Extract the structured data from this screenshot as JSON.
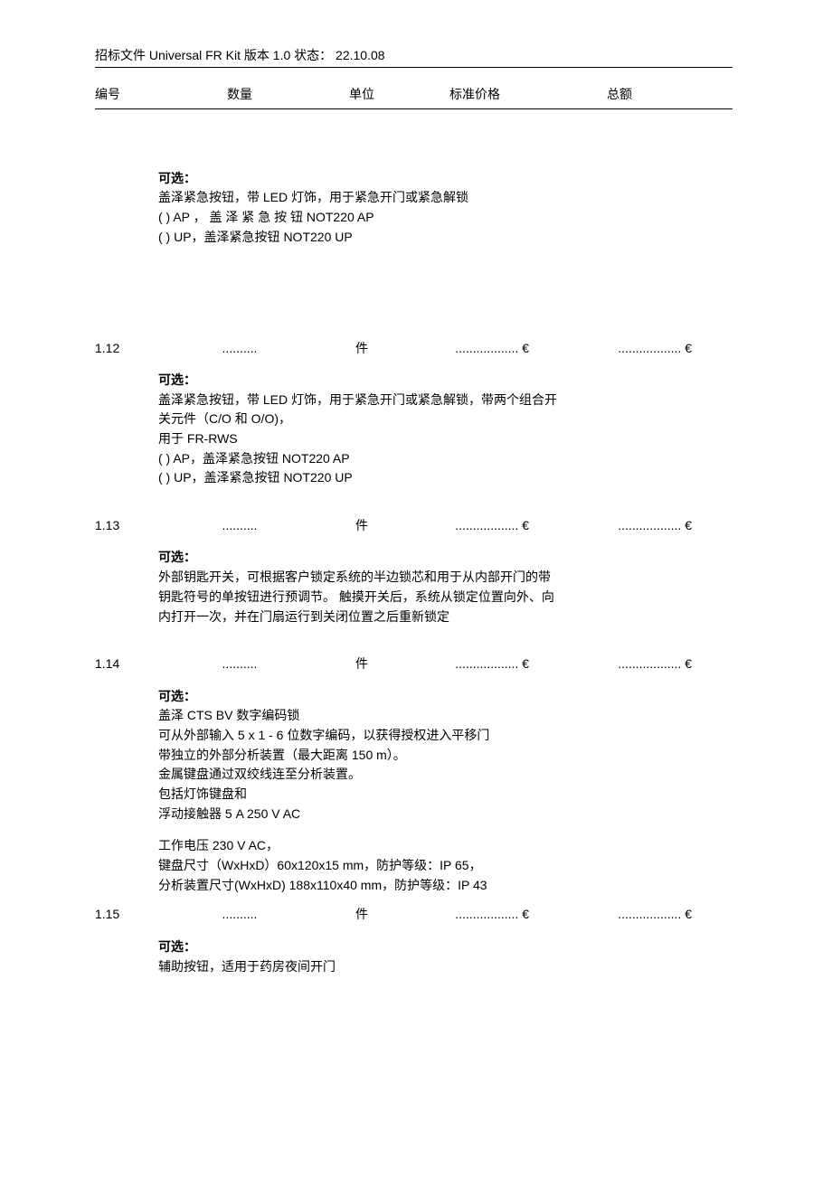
{
  "header": {
    "doc_title": "招标文件 Universal FR Kit  版本 1.0   状态：  22.10.08"
  },
  "columns": {
    "num": "编号",
    "qty": "数量",
    "unit": "单位",
    "price": "标准价格",
    "total": "总额"
  },
  "common": {
    "optional": "可选：",
    "unit_piece": "件",
    "qty_dots": "..........",
    "price_dots": ".................. €",
    "total_dots": ".................. €"
  },
  "block_first": {
    "line1": "盖泽紧急按钮，带 LED 灯饰，用于紧急开门或紧急解锁",
    "line2": "(    )  AP  ，  盖  泽  紧  急  按  钮   NOT220   AP",
    "line3": "(  ) UP，盖泽紧急按钮 NOT220 UP"
  },
  "items": [
    {
      "num": "1.12",
      "desc": [
        "盖泽紧急按钮，带 LED 灯饰，用于紧急开门或紧急解锁，带两个组合开",
        "关元件（C/O 和 O/O)，",
        "用于 FR-RWS",
        "(  ) AP，盖泽紧急按钮 NOT220 AP",
        "(  ) UP，盖泽紧急按钮 NOT220 UP"
      ]
    },
    {
      "num": "1.13",
      "desc": [
        "外部钥匙开关，可根据客户锁定系统的半边锁芯和用于从内部开门的带",
        "钥匙符号的单按钮进行预调节。 触摸开关后，系统从锁定位置向外、向",
        "内打开一次，并在门扇运行到关闭位置之后重新锁定"
      ]
    },
    {
      "num": "1.14",
      "desc": [
        "盖泽 CTS BV 数字编码锁",
        "可从外部输入 5 x 1 - 6 位数字编码，以获得授权进入平移门",
        "带独立的外部分析装置（最大距离 150 m）。",
        "金属键盘通过双绞线连至分析装置。",
        "包括灯饰键盘和",
        "浮动接触器 5 A 250 V AC"
      ],
      "desc2": [
        "工作电压 230 V AC，",
        "键盘尺寸（WxHxD）60x120x15 mm，防护等级：IP 65，",
        "分析装置尺寸(WxHxD) 188x110x40 mm，防护等级：IP 43"
      ]
    },
    {
      "num": "1.15",
      "desc": [
        "辅助按钮，适用于药房夜间开门"
      ]
    }
  ]
}
